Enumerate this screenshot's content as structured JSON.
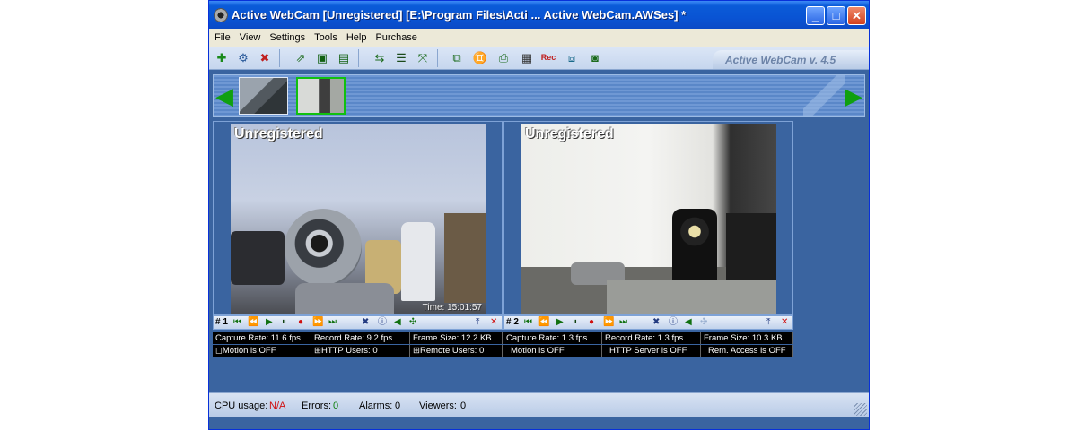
{
  "window": {
    "title": "Active WebCam [Unregistered] [E:\\Program Files\\Acti ... Active WebCam.AWSes] *",
    "minimize_label": "_",
    "maximize_label": "□",
    "close_label": "✕"
  },
  "menu": {
    "items": [
      "File",
      "View",
      "Settings",
      "Tools",
      "Help",
      "Purchase"
    ]
  },
  "toolbar": {
    "version": "Active WebCam v. 4.5",
    "icons": [
      "add-camera-icon",
      "camera-properties-icon",
      "remove-camera-icon",
      "open-session-icon",
      "save-session-icon",
      "save-as-icon",
      "import-icon",
      "log-icon",
      "fullscreen-icon",
      "layout-icon",
      "users-icon",
      "broadcast-icon",
      "film-icon",
      "record-icon",
      "screens-icon",
      "snapshot-icon"
    ],
    "record_glyph": "Rec"
  },
  "cameras": [
    {
      "number": "# 1",
      "overlay": "Unregistered",
      "time": "Time: 15:01:57",
      "capture_rate": "Capture Rate: 11.6 fps",
      "record_rate": "Record Rate: 9.2 fps",
      "frame_size": "Frame Size: 12.2 KB",
      "motion": "Motion is OFF",
      "http": "HTTP Users: 0",
      "remote": "Remote Users: 0"
    },
    {
      "number": "# 2",
      "overlay": "Unregistered",
      "time": "",
      "capture_rate": "Capture Rate: 1.3 fps",
      "record_rate": "Record Rate: 1.3 fps",
      "frame_size": "Frame Size: 10.3 KB",
      "motion": "Motion is OFF",
      "http": "HTTP Server is OFF",
      "remote": "Rem. Access is OFF"
    }
  ],
  "status": {
    "cpu_label": "CPU usage:",
    "cpu_value": "N/A",
    "errors_label": "Errors:",
    "errors_value": "0",
    "alarms_label": "Alarms:",
    "alarms_value": "0",
    "viewers_label": "Viewers:",
    "viewers_value": "0"
  },
  "colors": {
    "accent": "#0a5bd8",
    "workspace": "#3a64a0",
    "cpu_value": "#d01010",
    "errors_value": "#108010",
    "alarms_value": "#000000"
  }
}
